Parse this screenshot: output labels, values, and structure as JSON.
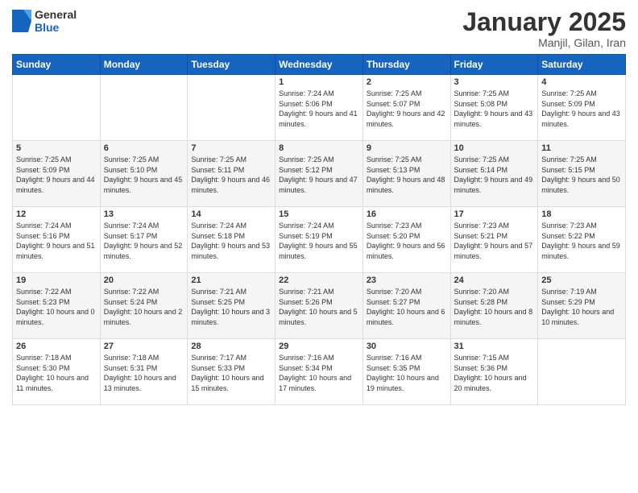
{
  "header": {
    "logo": {
      "general": "General",
      "blue": "Blue"
    },
    "title": "January 2025",
    "location": "Manjil, Gilan, Iran"
  },
  "calendar": {
    "days_of_week": [
      "Sunday",
      "Monday",
      "Tuesday",
      "Wednesday",
      "Thursday",
      "Friday",
      "Saturday"
    ],
    "weeks": [
      [
        {
          "day": "",
          "info": ""
        },
        {
          "day": "",
          "info": ""
        },
        {
          "day": "",
          "info": ""
        },
        {
          "day": "1",
          "info": "Sunrise: 7:24 AM\nSunset: 5:06 PM\nDaylight: 9 hours\nand 41 minutes."
        },
        {
          "day": "2",
          "info": "Sunrise: 7:25 AM\nSunset: 5:07 PM\nDaylight: 9 hours\nand 42 minutes."
        },
        {
          "day": "3",
          "info": "Sunrise: 7:25 AM\nSunset: 5:08 PM\nDaylight: 9 hours\nand 43 minutes."
        },
        {
          "day": "4",
          "info": "Sunrise: 7:25 AM\nSunset: 5:09 PM\nDaylight: 9 hours\nand 43 minutes."
        }
      ],
      [
        {
          "day": "5",
          "info": "Sunrise: 7:25 AM\nSunset: 5:09 PM\nDaylight: 9 hours\nand 44 minutes."
        },
        {
          "day": "6",
          "info": "Sunrise: 7:25 AM\nSunset: 5:10 PM\nDaylight: 9 hours\nand 45 minutes."
        },
        {
          "day": "7",
          "info": "Sunrise: 7:25 AM\nSunset: 5:11 PM\nDaylight: 9 hours\nand 46 minutes."
        },
        {
          "day": "8",
          "info": "Sunrise: 7:25 AM\nSunset: 5:12 PM\nDaylight: 9 hours\nand 47 minutes."
        },
        {
          "day": "9",
          "info": "Sunrise: 7:25 AM\nSunset: 5:13 PM\nDaylight: 9 hours\nand 48 minutes."
        },
        {
          "day": "10",
          "info": "Sunrise: 7:25 AM\nSunset: 5:14 PM\nDaylight: 9 hours\nand 49 minutes."
        },
        {
          "day": "11",
          "info": "Sunrise: 7:25 AM\nSunset: 5:15 PM\nDaylight: 9 hours\nand 50 minutes."
        }
      ],
      [
        {
          "day": "12",
          "info": "Sunrise: 7:24 AM\nSunset: 5:16 PM\nDaylight: 9 hours\nand 51 minutes."
        },
        {
          "day": "13",
          "info": "Sunrise: 7:24 AM\nSunset: 5:17 PM\nDaylight: 9 hours\nand 52 minutes."
        },
        {
          "day": "14",
          "info": "Sunrise: 7:24 AM\nSunset: 5:18 PM\nDaylight: 9 hours\nand 53 minutes."
        },
        {
          "day": "15",
          "info": "Sunrise: 7:24 AM\nSunset: 5:19 PM\nDaylight: 9 hours\nand 55 minutes."
        },
        {
          "day": "16",
          "info": "Sunrise: 7:23 AM\nSunset: 5:20 PM\nDaylight: 9 hours\nand 56 minutes."
        },
        {
          "day": "17",
          "info": "Sunrise: 7:23 AM\nSunset: 5:21 PM\nDaylight: 9 hours\nand 57 minutes."
        },
        {
          "day": "18",
          "info": "Sunrise: 7:23 AM\nSunset: 5:22 PM\nDaylight: 9 hours\nand 59 minutes."
        }
      ],
      [
        {
          "day": "19",
          "info": "Sunrise: 7:22 AM\nSunset: 5:23 PM\nDaylight: 10 hours\nand 0 minutes."
        },
        {
          "day": "20",
          "info": "Sunrise: 7:22 AM\nSunset: 5:24 PM\nDaylight: 10 hours\nand 2 minutes."
        },
        {
          "day": "21",
          "info": "Sunrise: 7:21 AM\nSunset: 5:25 PM\nDaylight: 10 hours\nand 3 minutes."
        },
        {
          "day": "22",
          "info": "Sunrise: 7:21 AM\nSunset: 5:26 PM\nDaylight: 10 hours\nand 5 minutes."
        },
        {
          "day": "23",
          "info": "Sunrise: 7:20 AM\nSunset: 5:27 PM\nDaylight: 10 hours\nand 6 minutes."
        },
        {
          "day": "24",
          "info": "Sunrise: 7:20 AM\nSunset: 5:28 PM\nDaylight: 10 hours\nand 8 minutes."
        },
        {
          "day": "25",
          "info": "Sunrise: 7:19 AM\nSunset: 5:29 PM\nDaylight: 10 hours\nand 10 minutes."
        }
      ],
      [
        {
          "day": "26",
          "info": "Sunrise: 7:18 AM\nSunset: 5:30 PM\nDaylight: 10 hours\nand 11 minutes."
        },
        {
          "day": "27",
          "info": "Sunrise: 7:18 AM\nSunset: 5:31 PM\nDaylight: 10 hours\nand 13 minutes."
        },
        {
          "day": "28",
          "info": "Sunrise: 7:17 AM\nSunset: 5:33 PM\nDaylight: 10 hours\nand 15 minutes."
        },
        {
          "day": "29",
          "info": "Sunrise: 7:16 AM\nSunset: 5:34 PM\nDaylight: 10 hours\nand 17 minutes."
        },
        {
          "day": "30",
          "info": "Sunrise: 7:16 AM\nSunset: 5:35 PM\nDaylight: 10 hours\nand 19 minutes."
        },
        {
          "day": "31",
          "info": "Sunrise: 7:15 AM\nSunset: 5:36 PM\nDaylight: 10 hours\nand 20 minutes."
        },
        {
          "day": "",
          "info": ""
        }
      ]
    ]
  }
}
